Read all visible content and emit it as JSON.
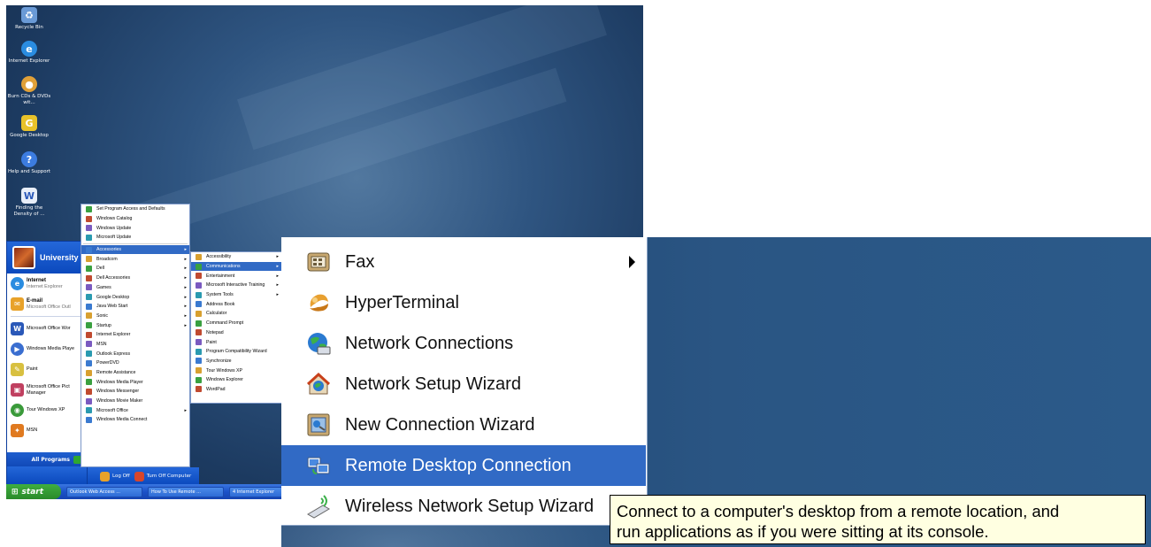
{
  "desktop_icons": [
    {
      "name": "recycle-bin-icon",
      "label": "Recycle Bin",
      "color": "#6a9ad6"
    },
    {
      "name": "internet-explorer-icon",
      "label": "Internet Explorer",
      "color": "#2a8ce0"
    },
    {
      "name": "burn-cds-icon",
      "label": "Burn CDs & DVDs wit...",
      "color": "#e0a038"
    },
    {
      "name": "google-desktop-icon",
      "label": "Google Desktop",
      "color": "#e8c22a"
    },
    {
      "name": "help-support-icon",
      "label": "Help and Support",
      "color": "#3c7ce0"
    },
    {
      "name": "document-icon",
      "label": "Finding the Density of ...",
      "color": "#e8eef8"
    }
  ],
  "start_menu": {
    "user_name": "University",
    "pinned": [
      {
        "name": "internet-item",
        "title": "Internet",
        "subtitle": "Internet Explorer",
        "color": "#2a8ce0"
      },
      {
        "name": "email-item",
        "title": "E-mail",
        "subtitle": "Microsoft Office Outl",
        "color": "#e8a22a"
      }
    ],
    "recent": [
      {
        "name": "word-item",
        "label": "Microsoft Office Wor",
        "color": "#2a58b8"
      },
      {
        "name": "media-player-item",
        "label": "Windows Media Playe",
        "color": "#3a6ed0"
      },
      {
        "name": "paint-item",
        "label": "Paint",
        "color": "#d8c040"
      },
      {
        "name": "picture-manager-item",
        "label": "Microsoft Office Pict Manager",
        "color": "#c04060"
      },
      {
        "name": "tour-xp-item",
        "label": "Tour Windows XP",
        "color": "#3a9a3a"
      },
      {
        "name": "msn-item",
        "label": "MSN",
        "color": "#e07a20"
      }
    ],
    "all_programs": "All Programs",
    "log_off": "Log Off",
    "turn_off": "Turn Off Computer"
  },
  "programs_menu": {
    "top": [
      "Set Program Access and Defaults",
      "Windows Catalog",
      "Windows Update",
      "Microsoft Update"
    ],
    "items": [
      {
        "label": "Accessories",
        "arrow": "▸",
        "highlight": true
      },
      {
        "label": "Broadcom",
        "arrow": "▸"
      },
      {
        "label": "Dell",
        "arrow": "▸"
      },
      {
        "label": "Dell Accessories",
        "arrow": "▸"
      },
      {
        "label": "Games",
        "arrow": "▸"
      },
      {
        "label": "Google Desktop",
        "arrow": "▸"
      },
      {
        "label": "Java Web Start",
        "arrow": "▸"
      },
      {
        "label": "Sonic",
        "arrow": "▸"
      },
      {
        "label": "Startup",
        "arrow": "▸"
      },
      {
        "label": "Internet Explorer",
        "arrow": ""
      },
      {
        "label": "MSN",
        "arrow": ""
      },
      {
        "label": "Outlook Express",
        "arrow": ""
      },
      {
        "label": "PowerDVD",
        "arrow": ""
      },
      {
        "label": "Remote Assistance",
        "arrow": ""
      },
      {
        "label": "Windows Media Player",
        "arrow": ""
      },
      {
        "label": "Windows Messenger",
        "arrow": ""
      },
      {
        "label": "Windows Movie Maker",
        "arrow": ""
      },
      {
        "label": "Microsoft Office",
        "arrow": "▸"
      },
      {
        "label": "Windows Media Connect",
        "arrow": ""
      }
    ]
  },
  "accessories_menu": [
    {
      "label": "Accessibility",
      "arrow": "▸"
    },
    {
      "label": "Communications",
      "arrow": "▸",
      "highlight": true
    },
    {
      "label": "Entertainment",
      "arrow": "▸"
    },
    {
      "label": "Microsoft Interactive Training",
      "arrow": "▸"
    },
    {
      "label": "System Tools",
      "arrow": "▸"
    },
    {
      "label": "Address Book",
      "arrow": ""
    },
    {
      "label": "Calculator",
      "arrow": ""
    },
    {
      "label": "Command Prompt",
      "arrow": ""
    },
    {
      "label": "Notepad",
      "arrow": ""
    },
    {
      "label": "Paint",
      "arrow": ""
    },
    {
      "label": "Program Compatibility Wizard",
      "arrow": ""
    },
    {
      "label": "Synchronize",
      "arrow": ""
    },
    {
      "label": "Tour Windows XP",
      "arrow": ""
    },
    {
      "label": "Windows Explorer",
      "arrow": ""
    },
    {
      "label": "WordPad",
      "arrow": ""
    }
  ],
  "communications_menu_small": [
    "",
    "",
    ""
  ],
  "taskbar": {
    "start_label": "start",
    "tasks": [
      "Outlook Web Access ...",
      "How To Use Remote ...",
      "4 Internet Explorer"
    ]
  },
  "communications_menu": {
    "items": [
      {
        "name": "fax-item",
        "label": "Fax",
        "icon": "fax-icon",
        "has_submenu": true
      },
      {
        "name": "hyperterminal-item",
        "label": "HyperTerminal",
        "icon": "hyperterminal-icon"
      },
      {
        "name": "network-connections-item",
        "label": "Network Connections",
        "icon": "network-connections-icon"
      },
      {
        "name": "network-setup-wizard-item",
        "label": "Network Setup Wizard",
        "icon": "network-setup-icon"
      },
      {
        "name": "new-connection-wizard-item",
        "label": "New Connection Wizard",
        "icon": "new-connection-icon"
      },
      {
        "name": "remote-desktop-connection-item",
        "label": "Remote Desktop Connection",
        "icon": "remote-desktop-icon",
        "highlight": true
      },
      {
        "name": "wireless-network-setup-wizard-item",
        "label": "Wireless Network Setup Wizard",
        "icon": "wireless-icon"
      }
    ]
  },
  "tooltip": {
    "line1": "Connect to a computer's desktop from a remote location, and",
    "line2": "run applications as if you were sitting at its console."
  },
  "colors": {
    "highlight": "#316ac5",
    "tooltip_bg": "#ffffe1",
    "xp_blue": "#0b49bd",
    "start_green": "#2a8a2a"
  }
}
